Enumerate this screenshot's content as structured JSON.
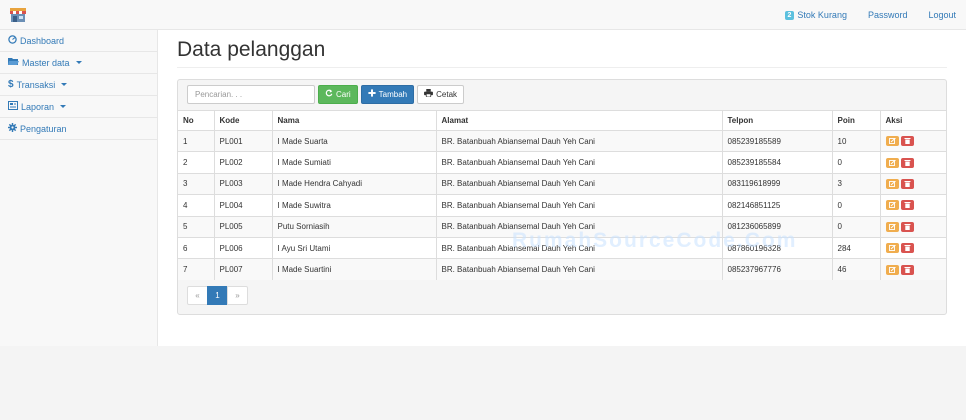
{
  "topbar": {
    "stok_badge": "2",
    "stok_label": "Stok Kurang",
    "password_label": "Password",
    "logout_label": "Logout"
  },
  "sidebar": {
    "items": [
      {
        "label": "Dashboard",
        "icon": "dashboard-icon"
      },
      {
        "label": "Master data",
        "icon": "folder-open-icon",
        "dropdown": true
      },
      {
        "label": "Transaksi",
        "icon": "dollar-icon",
        "dropdown": true
      },
      {
        "label": "Laporan",
        "icon": "report-icon",
        "dropdown": true
      },
      {
        "label": "Pengaturan",
        "icon": "gear-icon"
      }
    ]
  },
  "main": {
    "title": "Data pelanggan",
    "search_placeholder": "Pencarian. . .",
    "cari_label": "Cari",
    "tambah_label": "Tambah",
    "cetak_label": "Cetak"
  },
  "table": {
    "headers": [
      "No",
      "Kode",
      "Nama",
      "Alamat",
      "Telpon",
      "Poin",
      "Aksi"
    ],
    "rows": [
      [
        "1",
        "PL001",
        "I Made Suarta",
        "BR. Batanbuah Abiansemal Dauh Yeh Cani",
        "085239185589",
        "10"
      ],
      [
        "2",
        "PL002",
        "I Made Sumiati",
        "BR. Batanbuah Abiansemal Dauh Yeh Cani",
        "085239185584",
        "0"
      ],
      [
        "3",
        "PL003",
        "I Made Hendra Cahyadi",
        "BR. Batanbuah Abiansemal Dauh Yeh Cani",
        "083119618999",
        "3"
      ],
      [
        "4",
        "PL004",
        "I Made Suwitra",
        "BR. Batanbuah Abiansemal Dauh Yeh Cani",
        "082146851125",
        "0"
      ],
      [
        "5",
        "PL005",
        "Putu Sorniasih",
        "BR. Batanbuah Abiansemal Dauh Yeh Cani",
        "081236065899",
        "0"
      ],
      [
        "6",
        "PL006",
        "I Ayu Sri Utami",
        "BR. Batanbuah Abiansemal Dauh Yeh Cani",
        "087860196328",
        "284"
      ],
      [
        "7",
        "PL007",
        "I Made Suartini",
        "BR. Batanbuah Abiansemal Dauh Yeh Cani",
        "085237967776",
        "46"
      ]
    ]
  },
  "pagination": {
    "prev": "«",
    "current": "1",
    "next": "»"
  },
  "watermark": "RumahSourceCode.Com",
  "colors": {
    "primary": "#337ab7",
    "success": "#5cb85c",
    "warning": "#f0ad4e",
    "danger": "#d9534f",
    "badge": "#5bc0de"
  }
}
